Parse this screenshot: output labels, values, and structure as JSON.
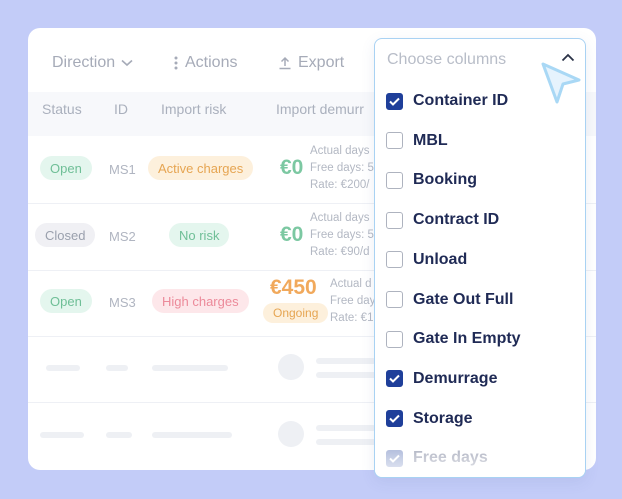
{
  "toolbar": {
    "direction_label": "Direction",
    "actions_label": "Actions",
    "export_label": "Export"
  },
  "table": {
    "headers": [
      "Status",
      "ID",
      "Import risk",
      "Import demurr"
    ],
    "rows": [
      {
        "status": "Open",
        "id": "MS1",
        "risk": "Active charges",
        "amount": "€0",
        "actual": "Actual days",
        "free": "Free days: 5",
        "rate": "Rate: €200/"
      },
      {
        "status": "Closed",
        "id": "MS2",
        "risk": "No risk",
        "amount": "€0",
        "actual": "Actual days",
        "free": "Free days: 5",
        "rate": "Rate: €90/d"
      },
      {
        "status": "Open",
        "id": "MS3",
        "risk": "High charges",
        "amount": "€450",
        "ongoing": "Ongoing",
        "actual": "Actual d",
        "free": "Free day",
        "rate": "Rate: €1"
      }
    ]
  },
  "dropdown": {
    "title": "Choose columns",
    "options": [
      {
        "label": "Container ID",
        "checked": true
      },
      {
        "label": "MBL",
        "checked": false
      },
      {
        "label": "Booking",
        "checked": false
      },
      {
        "label": "Contract ID",
        "checked": false
      },
      {
        "label": "Unload",
        "checked": false
      },
      {
        "label": "Gate Out Full",
        "checked": false
      },
      {
        "label": "Gate In Empty",
        "checked": false
      },
      {
        "label": "Demurrage",
        "checked": true
      },
      {
        "label": "Storage",
        "checked": true
      },
      {
        "label": "Free days",
        "checked": true
      }
    ]
  },
  "colors": {
    "background": "#c3ccf8",
    "checkbox_checked": "#1f3f9a",
    "dropdown_border": "#a9d2f3",
    "cursor": "#a9d8f5"
  }
}
